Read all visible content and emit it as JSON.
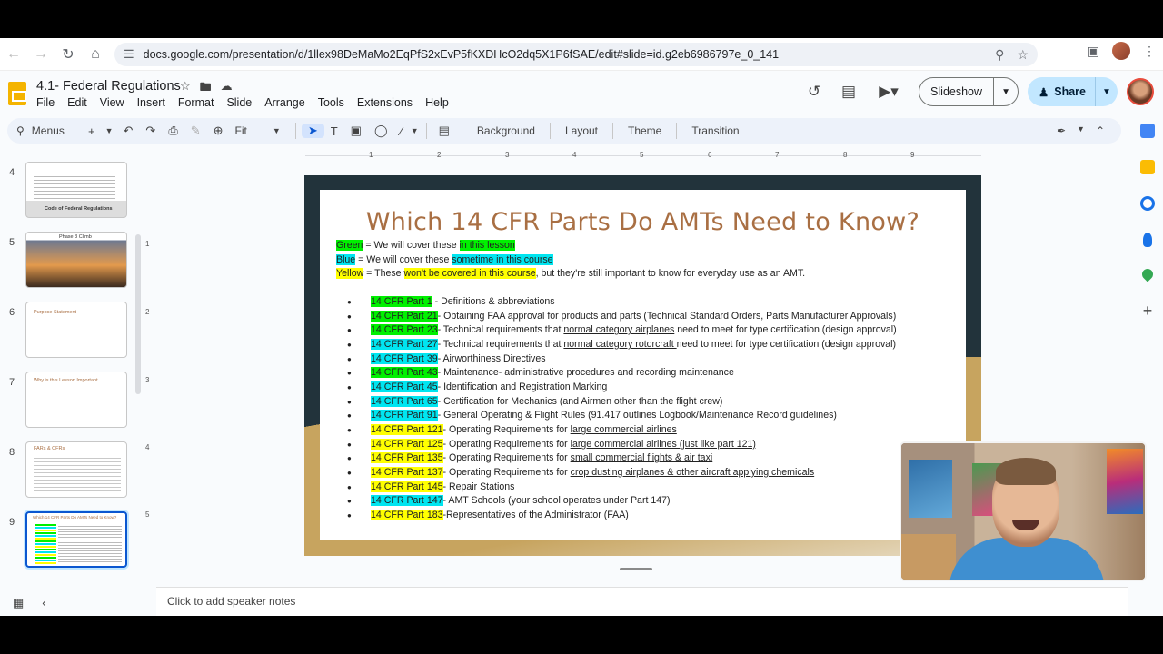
{
  "browser": {
    "url": "docs.google.com/presentation/d/1llex98DeMaMo2EqPfS2xEvP5fKXDHcO2dq5X1P6fSAE/edit#slide=id.g2eb6986797e_0_141"
  },
  "app": {
    "title": "4.1- Federal Regulations",
    "menus": [
      "File",
      "Edit",
      "View",
      "Insert",
      "Format",
      "Slide",
      "Arrange",
      "Tools",
      "Extensions",
      "Help"
    ],
    "slideshow_label": "Slideshow",
    "share_label": "Share"
  },
  "toolbar": {
    "menus_label": "Menus",
    "zoom_label": "Fit",
    "background_label": "Background",
    "layout_label": "Layout",
    "theme_label": "Theme",
    "transition_label": "Transition"
  },
  "filmstrip": {
    "slides": [
      {
        "num": "4",
        "caption": "Code of Federal Regulations"
      },
      {
        "num": "5",
        "caption": "Phase 3 Climb"
      },
      {
        "num": "6",
        "caption": "Purpose Statement"
      },
      {
        "num": "7",
        "caption": "Why is this Lesson Important"
      },
      {
        "num": "8",
        "caption": "FARs & CFRs"
      },
      {
        "num": "9",
        "caption": "Which 14 CFR Parts Do AMTs Need to Know?"
      }
    ]
  },
  "ruler": {
    "h_labels": [
      "1",
      "2",
      "3",
      "4",
      "5",
      "6",
      "7",
      "8",
      "9"
    ],
    "v_labels": [
      "1",
      "2",
      "3",
      "4",
      "5"
    ]
  },
  "slide": {
    "title": "Which 14 CFR Parts Do AMTs Need to Know?",
    "legend": {
      "green_word": "Green",
      "green_text": " = We will cover these ",
      "green_highlight": "in this lesson",
      "blue_word": "Blue",
      "blue_text": " = We will cover these ",
      "blue_highlight": "sometime in this course",
      "yellow_word": "Yellow",
      "yellow_text": " = These ",
      "yellow_highlight": "won't be covered in this course",
      "yellow_tail": ", but they're still important to know for everyday use as an AMT."
    },
    "colors": {
      "green": "#00f000",
      "blue": "#00e5f0",
      "yellow": "#ffff00",
      "title": "#a96f43"
    },
    "parts": [
      {
        "label": "14 CFR Part 1",
        "color": "green",
        "text": " - Definitions & abbreviations",
        "ul": "",
        "tail": ""
      },
      {
        "label": "14 CFR Part 21",
        "color": "green",
        "text": "- Obtaining FAA approval for products and parts (Technical Standard Orders, Parts Manufacturer Approvals)",
        "ul": "",
        "tail": ""
      },
      {
        "label": "14 CFR Part 23",
        "color": "green",
        "text": "- Technical requirements that ",
        "ul": "normal category airplanes",
        "tail": " need to meet for type certification (design approval)"
      },
      {
        "label": "14 CFR Part 27",
        "color": "blue",
        "text": "- Technical requirements that ",
        "ul": "normal category rotorcraft ",
        "tail": " need to meet for type certification (design approval)"
      },
      {
        "label": "14 CFR Part 39",
        "color": "blue",
        "text": "- Airworthiness Directives",
        "ul": "",
        "tail": ""
      },
      {
        "label": "14 CFR Part 43",
        "color": "green",
        "text": "- Maintenance- administrative procedures and recording maintenance",
        "ul": "",
        "tail": ""
      },
      {
        "label": "14 CFR Part 45",
        "color": "blue",
        "text": "- Identification and Registration Marking",
        "ul": "",
        "tail": ""
      },
      {
        "label": "14 CFR Part 65",
        "color": "blue",
        "text": "- Certification for Mechanics (and Airmen other than the flight crew)",
        "ul": "",
        "tail": ""
      },
      {
        "label": "14 CFR Part 91",
        "color": "blue",
        "text": "- General Operating & Flight Rules (91.417 outlines Logbook/Maintenance Record guidelines)",
        "ul": "",
        "tail": ""
      },
      {
        "label": "14 CFR Part 121",
        "color": "yellow",
        "text": "- Operating Requirements for ",
        "ul": "large commercial airlines",
        "tail": ""
      },
      {
        "label": "14 CFR Part 125",
        "color": "yellow",
        "text": "- Operating Requirements for ",
        "ul": "large commercial airlines (just like part 121)",
        "tail": ""
      },
      {
        "label": "14 CFR Part 135",
        "color": "yellow",
        "text": "- Operating Requirements for ",
        "ul": "small commercial flights & air taxi",
        "tail": ""
      },
      {
        "label": "14 CFR Part 137",
        "color": "yellow",
        "text": "- Operating Requirements for ",
        "ul": "crop dusting airplanes & other aircraft applying chemicals",
        "tail": ""
      },
      {
        "label": "14 CFR Part 145",
        "color": "yellow",
        "text": "- Repair Stations",
        "ul": "",
        "tail": ""
      },
      {
        "label": "14 CFR Part 147",
        "color": "blue",
        "text": "- AMT Schools (your school operates under Part 147)",
        "ul": "",
        "tail": ""
      },
      {
        "label": "14 CFR Part 183",
        "color": "yellow",
        "text": "-Representatives of the Administrator (FAA)",
        "ul": "",
        "tail": ""
      }
    ]
  },
  "notes": {
    "placeholder": "Click to add speaker notes"
  }
}
